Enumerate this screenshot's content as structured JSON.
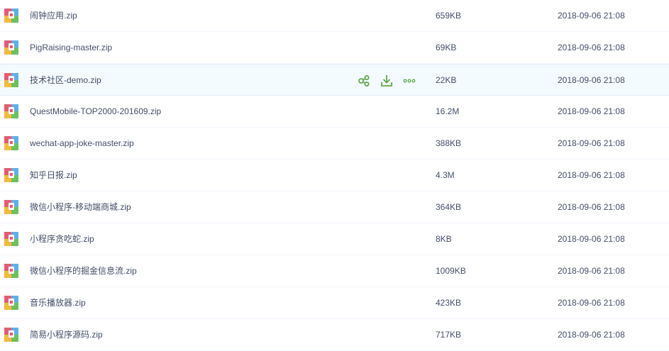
{
  "colors": {
    "accent": "#5fa84a",
    "text": "#424e67",
    "selected_row_bg": "#f4fbff",
    "row_divider": "#f2f6fd"
  },
  "files": [
    {
      "name": "闹钟应用.zip",
      "size": "659KB",
      "date": "2018-09-06 21:08",
      "icon": "zip-archive-icon"
    },
    {
      "name": "PigRaising-master.zip",
      "size": "69KB",
      "date": "2018-09-06 21:08",
      "icon": "zip-archive-icon"
    },
    {
      "name": "技术社区-demo.zip",
      "size": "22KB",
      "date": "2018-09-06 21:08",
      "icon": "zip-archive-icon",
      "selected": true
    },
    {
      "name": "QuestMobile-TOP2000-201609.zip",
      "size": "16.2M",
      "date": "2018-09-06 21:08",
      "icon": "zip-archive-icon"
    },
    {
      "name": "wechat-app-joke-master.zip",
      "size": "388KB",
      "date": "2018-09-06 21:08",
      "icon": "zip-archive-icon"
    },
    {
      "name": "知乎日报.zip",
      "size": "4.3M",
      "date": "2018-09-06 21:08",
      "icon": "zip-archive-icon"
    },
    {
      "name": "微信小程序-移动端商城.zip",
      "size": "364KB",
      "date": "2018-09-06 21:08",
      "icon": "zip-archive-icon"
    },
    {
      "name": "小程序贪吃蛇.zip",
      "size": "8KB",
      "date": "2018-09-06 21:08",
      "icon": "zip-archive-icon"
    },
    {
      "name": "微信小程序的掘金信息流.zip",
      "size": "1009KB",
      "date": "2018-09-06 21:08",
      "icon": "zip-archive-icon"
    },
    {
      "name": "音乐播放器.zip",
      "size": "423KB",
      "date": "2018-09-06 21:08",
      "icon": "zip-archive-icon"
    },
    {
      "name": "简易小程序源码.zip",
      "size": "717KB",
      "date": "2018-09-06 21:08",
      "icon": "zip-archive-icon"
    }
  ],
  "row_actions": {
    "share_icon": "share-icon",
    "download_icon": "download-icon",
    "more_icon": "more-icon"
  }
}
